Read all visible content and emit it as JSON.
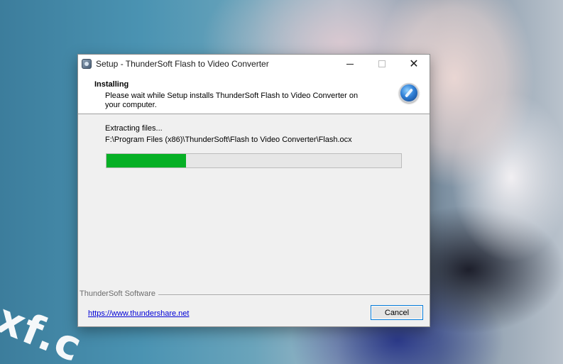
{
  "desktop": {
    "watermark": "xf.c"
  },
  "window": {
    "title": "Setup - ThunderSoft Flash to Video Converter",
    "controls": {
      "close_glyph": "✕"
    }
  },
  "header": {
    "title": "Installing",
    "description": "Please wait while Setup installs ThunderSoft Flash to Video Converter on your computer."
  },
  "progress": {
    "status": "Extracting files...",
    "current_file": "F:\\Program Files (x86)\\ThunderSoft\\Flash to Video Converter\\Flash.ocx",
    "percent": 27,
    "fill_color": "#06b025"
  },
  "footer": {
    "brand": "ThunderSoft Software",
    "link": "https://www.thundershare.net",
    "cancel_label": "Cancel"
  }
}
